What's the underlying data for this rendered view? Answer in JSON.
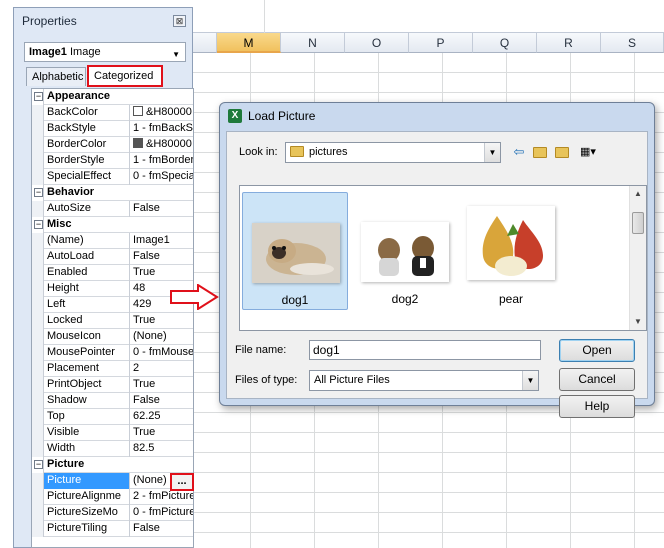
{
  "sheet": {
    "columns": [
      {
        "label": "M",
        "selected": true
      },
      {
        "label": "N",
        "selected": false
      },
      {
        "label": "O",
        "selected": false
      },
      {
        "label": "P",
        "selected": false
      },
      {
        "label": "Q",
        "selected": false
      },
      {
        "label": "R",
        "selected": false
      },
      {
        "label": "S",
        "selected": false
      }
    ]
  },
  "properties": {
    "title": "Properties",
    "close_glyph": "⊠",
    "object_name": "Image1",
    "object_type": "Image",
    "tabs": {
      "alphabetic": "Alphabetic",
      "categorized": "Categorized"
    },
    "categories": {
      "appearance": "Appearance",
      "behavior": "Behavior",
      "misc": "Misc",
      "picture": "Picture"
    },
    "rows": {
      "backcolor": {
        "name": "BackColor",
        "value": "&H80000"
      },
      "backstyle": {
        "name": "BackStyle",
        "value": "1 - fmBackSt"
      },
      "bordercolor": {
        "name": "BorderColor",
        "value": "&H80000"
      },
      "borderstyle": {
        "name": "BorderStyle",
        "value": "1 - fmBorder"
      },
      "specialeffect": {
        "name": "SpecialEffect",
        "value": "0 - fmSpecial"
      },
      "autosize": {
        "name": "AutoSize",
        "value": "False"
      },
      "name": {
        "name": "(Name)",
        "value": "Image1"
      },
      "autoload": {
        "name": "AutoLoad",
        "value": "False"
      },
      "enabled": {
        "name": "Enabled",
        "value": "True"
      },
      "height": {
        "name": "Height",
        "value": "48"
      },
      "left": {
        "name": "Left",
        "value": "429"
      },
      "locked": {
        "name": "Locked",
        "value": "True"
      },
      "mouseicon": {
        "name": "MouseIcon",
        "value": "(None)"
      },
      "mousepointer": {
        "name": "MousePointer",
        "value": "0 - fmMouseI"
      },
      "placement": {
        "name": "Placement",
        "value": "2"
      },
      "printobject": {
        "name": "PrintObject",
        "value": "True"
      },
      "shadow": {
        "name": "Shadow",
        "value": "False"
      },
      "top": {
        "name": "Top",
        "value": "62.25"
      },
      "visible": {
        "name": "Visible",
        "value": "True"
      },
      "width": {
        "name": "Width",
        "value": "82.5"
      },
      "picture": {
        "name": "Picture",
        "value": "(None)"
      },
      "picturealignment": {
        "name": "PictureAlignme",
        "value": "2 - fmPicture"
      },
      "picturesizemode": {
        "name": "PictureSizeMo",
        "value": "0 - fmPicture"
      },
      "picturetiling": {
        "name": "PictureTiling",
        "value": "False"
      }
    },
    "ellipsis_label": "..."
  },
  "dialog": {
    "title": "Load Picture",
    "app_icon_letter": "X",
    "look_in_label": "Look in:",
    "look_in_value": "pictures",
    "toolbar": {
      "back": "⇦",
      "up": "↑",
      "new_folder": "✦",
      "views": "▦▾"
    },
    "files": [
      {
        "caption": "dog1",
        "selected": true
      },
      {
        "caption": "dog2",
        "selected": false
      },
      {
        "caption": "pear",
        "selected": false
      }
    ],
    "file_name_label": "File name:",
    "file_name_value": "dog1",
    "file_type_label": "Files of type:",
    "file_type_value": "All Picture Files",
    "buttons": {
      "open": "Open",
      "cancel": "Cancel",
      "help": "Help"
    }
  },
  "colors": {
    "highlight_red": "#e0101a",
    "selection_blue": "#3399ff",
    "arrow_red": "#e0101a"
  }
}
